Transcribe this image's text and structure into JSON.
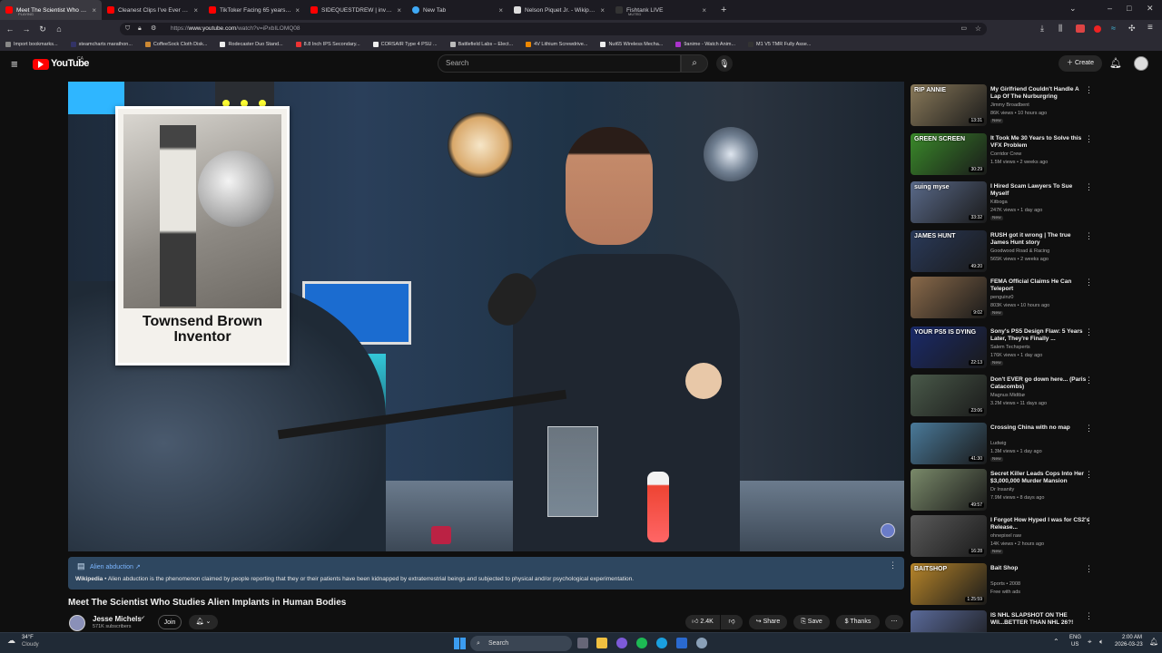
{
  "browser": {
    "tabs": [
      {
        "title": "Meet The Scientist Who Studie",
        "subtitle": "PLAYING",
        "active": true
      },
      {
        "title": "Cleanest Clips I've Ever Hit.. (Ji"
      },
      {
        "title": "TikToker Facing 65 years in Pris"
      },
      {
        "title": "SIDEQUESTDREW | investigate"
      },
      {
        "title": "New Tab"
      },
      {
        "title": "Nelson Piquet Jr. - Wikipedia"
      },
      {
        "title": "Fishtank LIVE",
        "subtitle": "MUTED"
      }
    ],
    "url_domain": "www.youtube.com",
    "url_path": "/watch?v=iPxbILOMQ08",
    "url_prefix": "https://",
    "bookmarks": [
      "Import bookmarks...",
      "steamcharts marathon...",
      "CoffeeSock Cloth Disk...",
      "Rodecaster Duo Stand...",
      "8.8 Inch IPS Secondary...",
      "CORSAIR Type 4 PSU ...",
      "Battlefield Labs – Elect...",
      "4V Lithium Screwdrive...",
      "Nut65 Wireless Mecha...",
      "9anime - Watch Anim...",
      "M1 V5 TMR Fully Asse..."
    ]
  },
  "youtube": {
    "logo": "YouTube",
    "region": "CA",
    "search_placeholder": "Search",
    "create_label": "Create"
  },
  "video": {
    "overlay_caption_line1": "Townsend Brown",
    "overlay_caption_line2": "Inventor",
    "info_panel": {
      "title": "Alien abduction",
      "source": "Wikipedia",
      "text": "Alien abduction is the phenomenon claimed by people reporting that they or their patients have been kidnapped by extraterrestrial beings and subjected to physical and/or psychological experimentation."
    },
    "title": "Meet The Scientist Who Studies Alien Implants in Human Bodies",
    "channel": "Jesse Michels",
    "subscribers": "571K subscribers",
    "join_label": "Join",
    "likes": "2.4K",
    "share_label": "Share",
    "save_label": "Save",
    "thanks_label": "Thanks"
  },
  "recommendations": [
    {
      "title": "My Girlfriend Couldn't Handle A Lap Of The Nurburgring",
      "channel": "Jimmy Broadbent",
      "meta": "86K views • 10 hours ago",
      "badge": "New",
      "duration": "13:31",
      "thumb_text": "RIP ANNIE",
      "color": "#8a7a5a"
    },
    {
      "title": "It Took Me 30 Years to Solve this VFX Problem",
      "channel": "Corridor Crew",
      "meta": "1.5M views • 2 weeks ago",
      "badge": "",
      "duration": "30:29",
      "thumb_text": "GREEN SCREEN",
      "color": "#3a8a2a"
    },
    {
      "title": "I Hired Scam Lawyers To Sue Myself",
      "channel": "Kitboga",
      "meta": "247K views • 1 day ago",
      "badge": "New",
      "duration": "33:32",
      "thumb_text": "suing myse",
      "color": "#5a6a8a"
    },
    {
      "title": "RUSH got it wrong | The true James Hunt story",
      "channel": "Goodwood Road & Racing",
      "meta": "565K views • 2 weeks ago",
      "badge": "",
      "duration": "49:20",
      "thumb_text": "JAMES HUNT",
      "color": "#2a3a5a"
    },
    {
      "title": "FEMA Official Claims He Can Teleport",
      "channel": "penguinz0",
      "meta": "803K views • 10 hours ago",
      "badge": "New",
      "duration": "9:02",
      "thumb_text": "",
      "color": "#8a6a4a"
    },
    {
      "title": "Sony's PS5 Design Flaw: 5 Years Later, They're Finally ...",
      "channel": "Salem Techsperts",
      "meta": "176K views • 1 day ago",
      "badge": "New",
      "duration": "22:13",
      "thumb_text": "YOUR PS5 IS DYING",
      "color": "#1a2a6a"
    },
    {
      "title": "Don't EVER go down here... (Paris Catacombs)",
      "channel": "Magnus Midtbø",
      "meta": "3.2M views • 11 days ago",
      "badge": "",
      "duration": "23:06",
      "thumb_text": "",
      "color": "#4a5a4a"
    },
    {
      "title": "Crossing China with no map",
      "channel": "Ludwig",
      "meta": "1.3M views • 1 day ago",
      "badge": "New",
      "duration": "41:30",
      "thumb_text": "",
      "color": "#4a7a9a"
    },
    {
      "title": "Secret Killer Leads Cops Into Her $3,000,000 Murder Mansion",
      "channel": "Dr Insanity",
      "meta": "7.9M views • 8 days ago",
      "badge": "",
      "duration": "49:57",
      "thumb_text": "",
      "color": "#7a8a6a"
    },
    {
      "title": "I Forgot How Hyped I was for CS2's Release...",
      "channel": "ohnepixel raw",
      "meta": "14K views • 2 hours ago",
      "badge": "New",
      "duration": "16:28",
      "thumb_text": "",
      "color": "#5a5a5a"
    },
    {
      "title": "Bait Shop",
      "channel": "Sports • 2008",
      "meta": "Free with ads",
      "badge": "",
      "duration": "1:25:59",
      "thumb_text": "BAITSHOP",
      "color": "#b8862a"
    },
    {
      "title": "IS NHL SLAPSHOT ON THE WII...BETTER THAN NHL 26?!",
      "channel": "",
      "meta": "",
      "badge": "",
      "duration": "",
      "thumb_text": "",
      "color": "#5a6a9a"
    }
  ],
  "taskbar": {
    "weather_temp": "34°F",
    "weather_text": "Cloudy",
    "search_placeholder": "Search",
    "lang": "ENG",
    "region": "US",
    "time": "2:00 AM",
    "date": "2026-03-23"
  },
  "colors": {
    "youtube_red": "#ff0000",
    "info_panel_bg": "#2e4760",
    "link_blue": "#7cb6ff"
  }
}
